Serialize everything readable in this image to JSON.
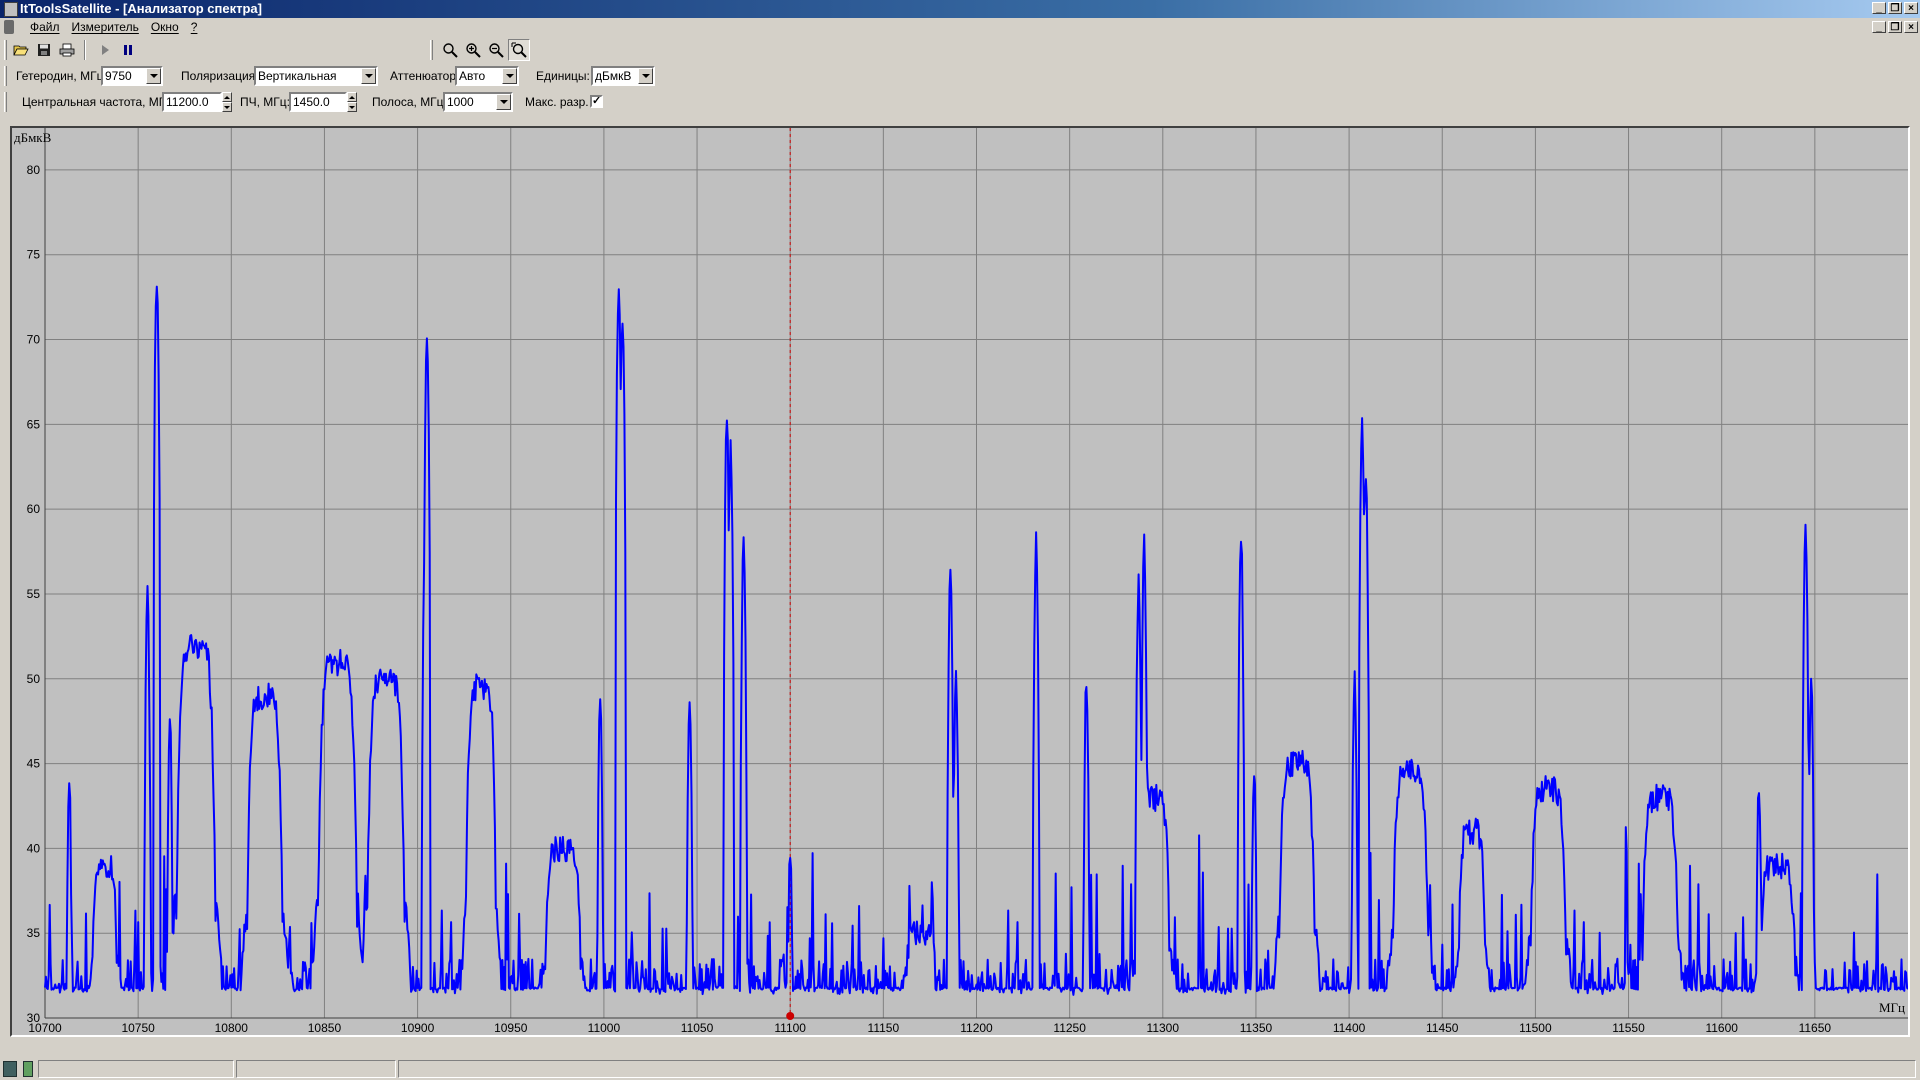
{
  "window": {
    "title": "ItToolsSatellite - [Анализатор спектра]"
  },
  "menu": [
    "Файл",
    "Измеритель",
    "Окно",
    "?"
  ],
  "toolbar": {
    "icons": [
      "open-folder-icon",
      "save-icon",
      "print-icon",
      "play-icon",
      "pause-icon",
      "zoom-icon",
      "zoom-in-icon",
      "zoom-out-icon",
      "zoom-fit-icon"
    ]
  },
  "controls": {
    "lo_label": "Гетеродин, МГц:",
    "lo_value": "9750",
    "pol_label": "Поляризация:",
    "pol_value": "Вертикальная",
    "att_label": "Аттенюатор:",
    "att_value": "Авто",
    "units_label": "Единицы:",
    "units_value": "дБмкВ",
    "cf_label": "Центральная частота, МГц:",
    "cf_value": "11200.0",
    "if_label": "ПЧ, МГц:",
    "if_value": "1450.0",
    "bw_label": "Полоса, МГц:",
    "bw_value": "1000",
    "maxres_label": "Макс. разр.",
    "maxres_checked": true
  },
  "chart_data": {
    "type": "line",
    "ylabel": "дБмкВ",
    "xlabel": "МГц",
    "xlim": [
      10700,
      11700
    ],
    "ylim": [
      30,
      82
    ],
    "xticks": [
      10700,
      10750,
      10800,
      10850,
      10900,
      10950,
      11000,
      11050,
      11100,
      11150,
      11200,
      11250,
      11300,
      11350,
      11400,
      11450,
      11500,
      11550,
      11600,
      11650
    ],
    "yticks": [
      30,
      35,
      40,
      45,
      50,
      55,
      60,
      65,
      70,
      75,
      80
    ],
    "marker_freq": 11100,
    "noise_floor": 31,
    "colors": {
      "background": "#c0c0c0",
      "grid": "#808080",
      "trace": "#0000ff",
      "marker": "#cc0000"
    },
    "transponders": [
      {
        "center": 10732,
        "width": 14,
        "level": 39
      },
      {
        "center": 10781,
        "width": 22,
        "level": 52
      },
      {
        "center": 10818,
        "width": 20,
        "level": 49
      },
      {
        "center": 10857,
        "width": 22,
        "level": 51
      },
      {
        "center": 10883,
        "width": 21,
        "level": 50
      },
      {
        "center": 10934,
        "width": 17,
        "level": 49.5
      },
      {
        "center": 10978,
        "width": 20,
        "level": 40
      },
      {
        "center": 11170,
        "width": 17,
        "level": 35
      },
      {
        "center": 11295,
        "width": 18,
        "level": 43
      },
      {
        "center": 11372,
        "width": 20,
        "level": 45
      },
      {
        "center": 11433,
        "width": 20,
        "level": 44.5
      },
      {
        "center": 11466,
        "width": 15,
        "level": 41
      },
      {
        "center": 11507,
        "width": 20,
        "level": 43.5
      },
      {
        "center": 11567,
        "width": 20,
        "level": 43
      },
      {
        "center": 11630,
        "width": 20,
        "level": 39
      }
    ],
    "carriers": [
      {
        "freq": 10713,
        "level": 44
      },
      {
        "freq": 10755,
        "level": 55
      },
      {
        "freq": 10760,
        "level": 73.8
      },
      {
        "freq": 10767,
        "level": 48
      },
      {
        "freq": 10905,
        "level": 70.3
      },
      {
        "freq": 10904,
        "level": 59
      },
      {
        "freq": 10998,
        "level": 49
      },
      {
        "freq": 11008,
        "level": 73.4
      },
      {
        "freq": 11010,
        "level": 71.5
      },
      {
        "freq": 11046,
        "level": 49
      },
      {
        "freq": 11066,
        "level": 65
      },
      {
        "freq": 11068,
        "level": 63.8
      },
      {
        "freq": 11075,
        "level": 58.5
      },
      {
        "freq": 11100,
        "level": 40
      },
      {
        "freq": 11186,
        "level": 56.7
      },
      {
        "freq": 11189,
        "level": 50
      },
      {
        "freq": 11232,
        "level": 58
      },
      {
        "freq": 11259,
        "level": 50
      },
      {
        "freq": 11287,
        "level": 55.5
      },
      {
        "freq": 11290,
        "level": 58
      },
      {
        "freq": 11342,
        "level": 58.5
      },
      {
        "freq": 11349,
        "level": 45
      },
      {
        "freq": 11403,
        "level": 50
      },
      {
        "freq": 11407,
        "level": 65
      },
      {
        "freq": 11409,
        "level": 61.5
      },
      {
        "freq": 11620,
        "level": 44
      },
      {
        "freq": 11645,
        "level": 59.3
      },
      {
        "freq": 11648,
        "level": 50
      }
    ]
  }
}
